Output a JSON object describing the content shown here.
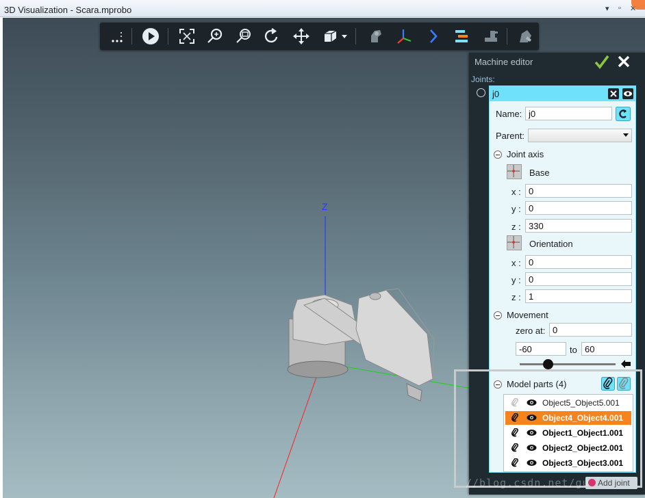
{
  "window": {
    "title": "3D Visualization - Scara.mprobo",
    "controls": [
      "▾",
      "▫",
      "✕"
    ]
  },
  "toolbar": {
    "buttons": [
      "more-icon",
      "play-icon",
      "fit-view-icon",
      "zoom-icon",
      "zoom-window-icon",
      "rotate-icon",
      "pan-icon",
      "view-cube-icon",
      "robot-icon",
      "frame-axes-icon",
      "chevron-right-icon",
      "timeline-icon",
      "tool-icon",
      "part-icon"
    ]
  },
  "viewport": {
    "axis_label_z": "Z"
  },
  "editor": {
    "title": "Machine editor",
    "joints_label": "Joints:",
    "joint": {
      "name_header": "j0",
      "name_label": "Name:",
      "name_value": "j0",
      "parent_label": "Parent:",
      "parent_value": "",
      "joint_axis_label": "Joint axis",
      "base_label": "Base",
      "base": {
        "x_label": "x :",
        "x": "0",
        "y_label": "y :",
        "y": "0",
        "z_label": "z :",
        "z": "330"
      },
      "orientation_label": "Orientation",
      "orientation": {
        "x_label": "x :",
        "x": "0",
        "y_label": "y :",
        "y": "0",
        "z_label": "z :",
        "z": "1"
      },
      "movement_label": "Movement",
      "zero_at_label": "zero at:",
      "zero_at": "0",
      "range_min": "-60",
      "range_to_label": "to",
      "range_max": "60",
      "slider_fraction": 0.29,
      "model_parts_label": "Model parts (4)",
      "parts": [
        {
          "name": "Object5_Object5.001",
          "attached": false,
          "selected": false
        },
        {
          "name": "Object4_Object4.001",
          "attached": true,
          "selected": true
        },
        {
          "name": "Object1_Object1.001",
          "attached": true,
          "selected": false
        },
        {
          "name": "Object2_Object2.001",
          "attached": true,
          "selected": false
        },
        {
          "name": "Object3_Object3.001",
          "attached": true,
          "selected": false
        }
      ]
    },
    "add_joint_label": "Add joint"
  },
  "watermark": "//blog.csdn.net/gu",
  "colors": {
    "accent_cyan": "#6fe1fb",
    "selection_orange": "#f5841f",
    "ok_green": "#8cc63f",
    "panel_dark": "#1f2a31"
  }
}
